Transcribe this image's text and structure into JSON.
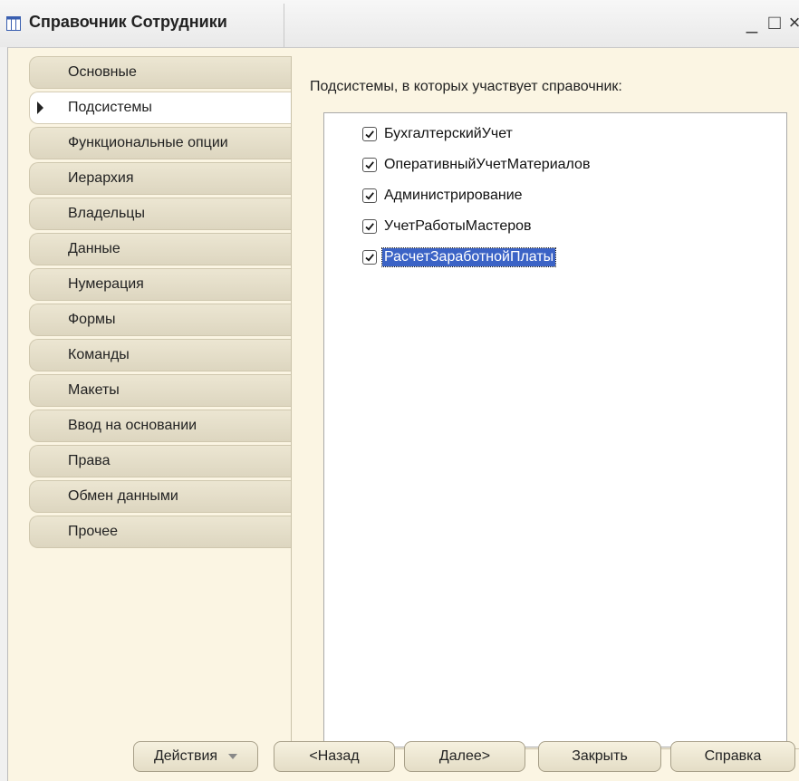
{
  "window": {
    "title": "Справочник Сотрудники",
    "minimize": "_",
    "maximize": "□",
    "close": "×"
  },
  "tabs": [
    {
      "label": "Основные",
      "active": false
    },
    {
      "label": "Подсистемы",
      "active": true
    },
    {
      "label": "Функциональные опции",
      "active": false
    },
    {
      "label": "Иерархия",
      "active": false
    },
    {
      "label": "Владельцы",
      "active": false
    },
    {
      "label": "Данные",
      "active": false
    },
    {
      "label": "Нумерация",
      "active": false
    },
    {
      "label": "Формы",
      "active": false
    },
    {
      "label": "Команды",
      "active": false
    },
    {
      "label": "Макеты",
      "active": false
    },
    {
      "label": "Ввод на основании",
      "active": false
    },
    {
      "label": "Права",
      "active": false
    },
    {
      "label": "Обмен данными",
      "active": false
    },
    {
      "label": "Прочее",
      "active": false
    }
  ],
  "content": {
    "heading": "Подсистемы, в которых участвует справочник:",
    "subsystems": [
      {
        "label": "БухгалтерскийУчет",
        "checked": true,
        "selected": false
      },
      {
        "label": "ОперативныйУчетМатериалов",
        "checked": true,
        "selected": false
      },
      {
        "label": "Администрирование",
        "checked": true,
        "selected": false
      },
      {
        "label": "УчетРаботыМастеров",
        "checked": true,
        "selected": false
      },
      {
        "label": "РасчетЗаработнойПлаты",
        "checked": true,
        "selected": true
      }
    ]
  },
  "buttons": {
    "actions": "Действия",
    "back": "<Назад",
    "next": "Далее>",
    "close": "Закрыть",
    "help": "Справка"
  }
}
